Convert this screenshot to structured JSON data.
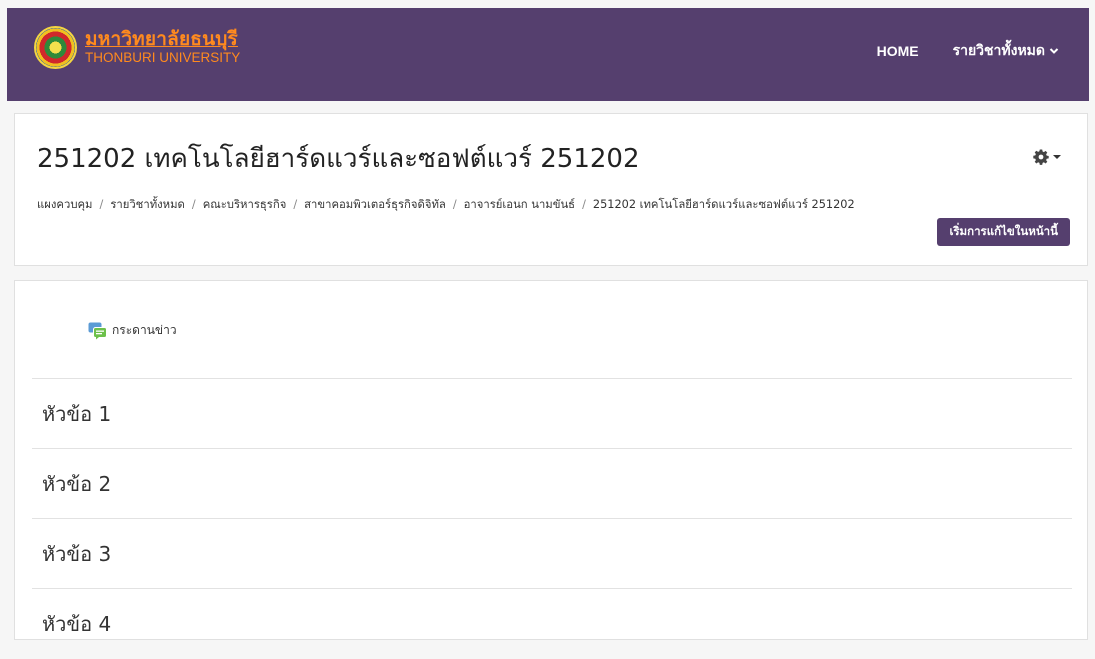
{
  "navbar": {
    "brand_thai": "มหาวิทยาลัยธนบุรี",
    "brand_en": "THONBURI UNIVERSITY",
    "home": "HOME",
    "all_courses": "รายวิชาทั้งหมด"
  },
  "header": {
    "title": "251202 เทคโนโลยีฮาร์ดแวร์และซอฟต์แวร์ 251202",
    "breadcrumb": [
      "แผงควบคุม",
      "รายวิชาทั้งหมด",
      "คณะบริหารธุรกิจ",
      "สาขาคอมพิวเตอร์ธุรกิจดิจิทัล",
      "อาจารย์เอนก นามขันธ์",
      "251202 เทคโนโลยีฮาร์ดแวร์และซอฟต์แวร์ 251202"
    ],
    "edit_button": "เริ่มการแก้ไขในหน้านี้"
  },
  "content": {
    "forum_label": "กระดานข่าว",
    "sections": [
      "หัวข้อ 1",
      "หัวข้อ 2",
      "หัวข้อ 3",
      "หัวข้อ 4"
    ]
  },
  "colors": {
    "brand_purple": "#553f6e",
    "brand_orange": "#ff8a1e"
  },
  "icons": {
    "gear": "gear-icon",
    "forum": "forum-icon",
    "chevron": "chevron-down-icon"
  }
}
